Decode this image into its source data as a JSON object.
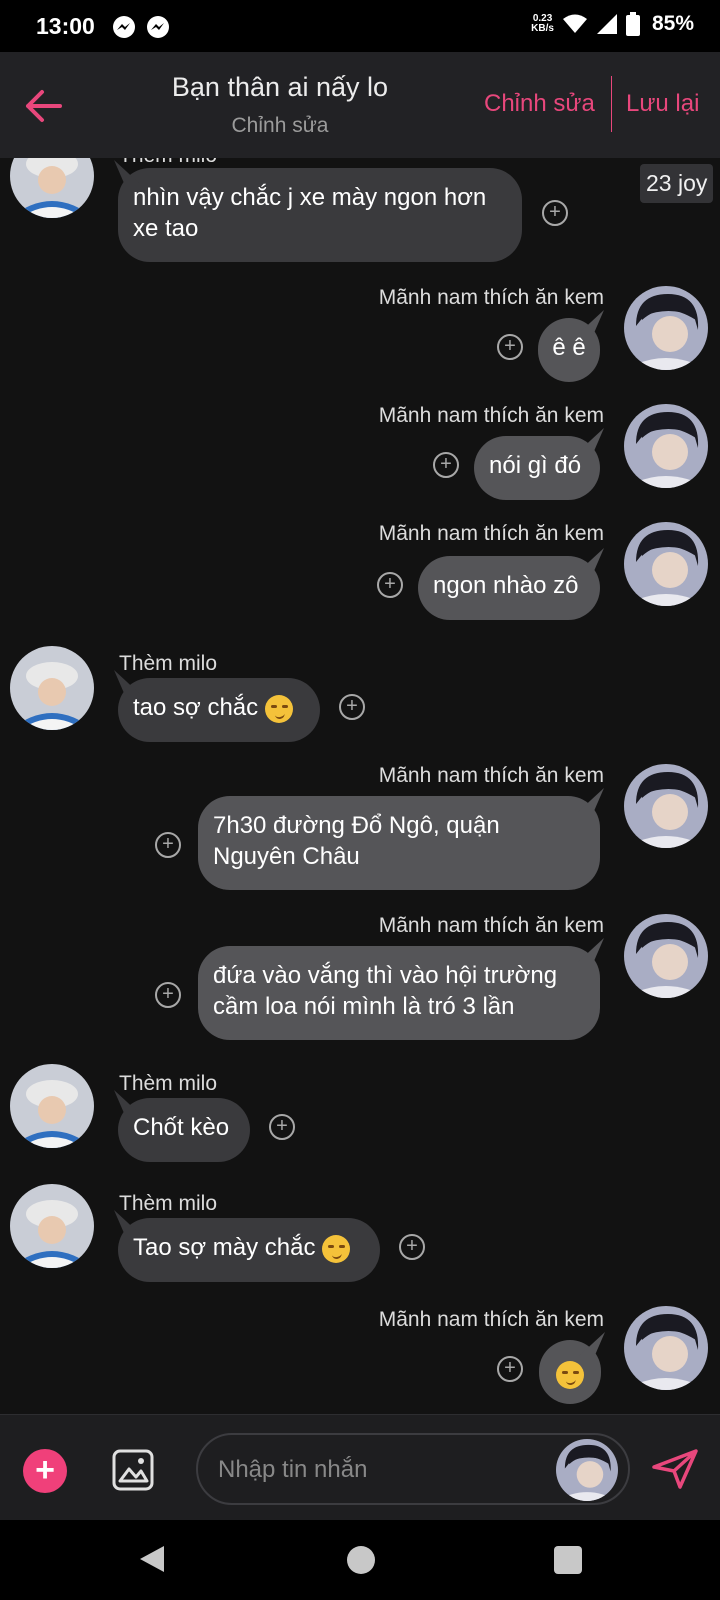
{
  "status_bar": {
    "time": "13:00",
    "net_speed_value": "0.23",
    "net_speed_unit": "KB/s",
    "battery": "85%",
    "icons": [
      "messenger-icon",
      "messenger-icon",
      "wifi-icon",
      "signal-icon",
      "battery-icon"
    ]
  },
  "header": {
    "title": "Bạn thân ai nấy lo",
    "subtitle": "Chỉnh sửa",
    "edit_label": "Chỉnh sửa",
    "save_label": "Lưu lại",
    "accent": "#e8477c"
  },
  "chat": {
    "badge": "23 joy",
    "messages": [
      {
        "sender": "Thèm milo",
        "side": "in",
        "text_lines": [
          "nhìn vậy chắc j xe mày ngon hơn",
          "xe tao"
        ]
      },
      {
        "sender": "Mãnh nam thích ăn kem",
        "side": "out",
        "text": "ê ê"
      },
      {
        "sender": "Mãnh nam thích ăn kem",
        "side": "out",
        "text": "nói gì đó"
      },
      {
        "sender": "Mãnh nam thích ăn kem",
        "side": "out",
        "text": "ngon nhào zô"
      },
      {
        "sender": "Thèm milo",
        "side": "in",
        "text": "tao sợ chắc",
        "emoji": "smirk"
      },
      {
        "sender": "Mãnh nam thích ăn kem",
        "side": "out",
        "text_lines": [
          "7h30 đường Đổ Ngô, quận",
          "Nguyên Châu"
        ]
      },
      {
        "sender": "Mãnh nam thích ăn kem",
        "side": "out",
        "text_lines": [
          "đứa vào vắng thì vào hội trường",
          "cầm loa nói mình là tró 3 lần"
        ]
      },
      {
        "sender": "Thèm milo",
        "side": "in",
        "text": "Chốt kèo"
      },
      {
        "sender": "Thèm milo",
        "side": "in",
        "text": "Tao sợ mày chắc",
        "emoji": "smirk"
      },
      {
        "sender": "Mãnh nam thích ăn kem",
        "side": "out",
        "text": "",
        "emoji": "smirk"
      }
    ]
  },
  "composer": {
    "placeholder": "Nhập tin nhắn",
    "icons": [
      "plus-icon",
      "image-icon",
      "send-icon"
    ]
  },
  "colors": {
    "background": "#121212",
    "incoming_bubble": "#3a3a3d",
    "outgoing_bubble": "#555558",
    "accent": "#e8477c"
  }
}
